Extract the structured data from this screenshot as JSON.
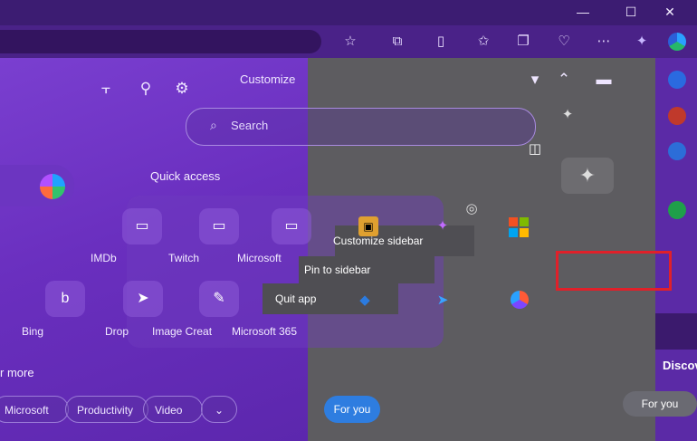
{
  "window_controls": {
    "minimize": "—",
    "maximize": "☐",
    "close": "✕"
  },
  "toolbar_icons": [
    "favorites-star-icon",
    "extensions-icon",
    "split-screen-icon",
    "favorites-icon",
    "collections-icon",
    "browser-essentials-icon",
    "more-icon",
    "copilot-icon",
    "profile-icon"
  ],
  "customize": {
    "title": "Customize",
    "search_placeholder": "Search"
  },
  "quick_access": {
    "title": "Quick access",
    "tiles": [
      {
        "label": "IMDb",
        "icon": "imdb-icon"
      },
      {
        "label": "Twitch",
        "icon": "twitch-icon"
      },
      {
        "label": "Microsoft",
        "icon": "microsoft-icon"
      },
      {
        "label": "Bing",
        "icon": "bing-icon"
      },
      {
        "label": "Drop",
        "icon": "drop-icon"
      },
      {
        "label": "Image Creat",
        "icon": "image-creator-icon"
      },
      {
        "label": "Microsoft 365",
        "icon": "m365-icon"
      }
    ]
  },
  "explore_more": {
    "title": "r more",
    "chips": [
      "Microsoft",
      "Productivity",
      "Video"
    ]
  },
  "context_menu": {
    "items": [
      "Customize sidebar",
      "Pin to sidebar",
      "Quit app"
    ]
  },
  "gray_area": {
    "for_you": "For you"
  },
  "right_side": {
    "discover": "Discov",
    "for_you": "For you"
  },
  "colors": {
    "accent": "#6a2fbf",
    "highlight": "#e0202a",
    "for_you_button": "#2e7de0"
  }
}
